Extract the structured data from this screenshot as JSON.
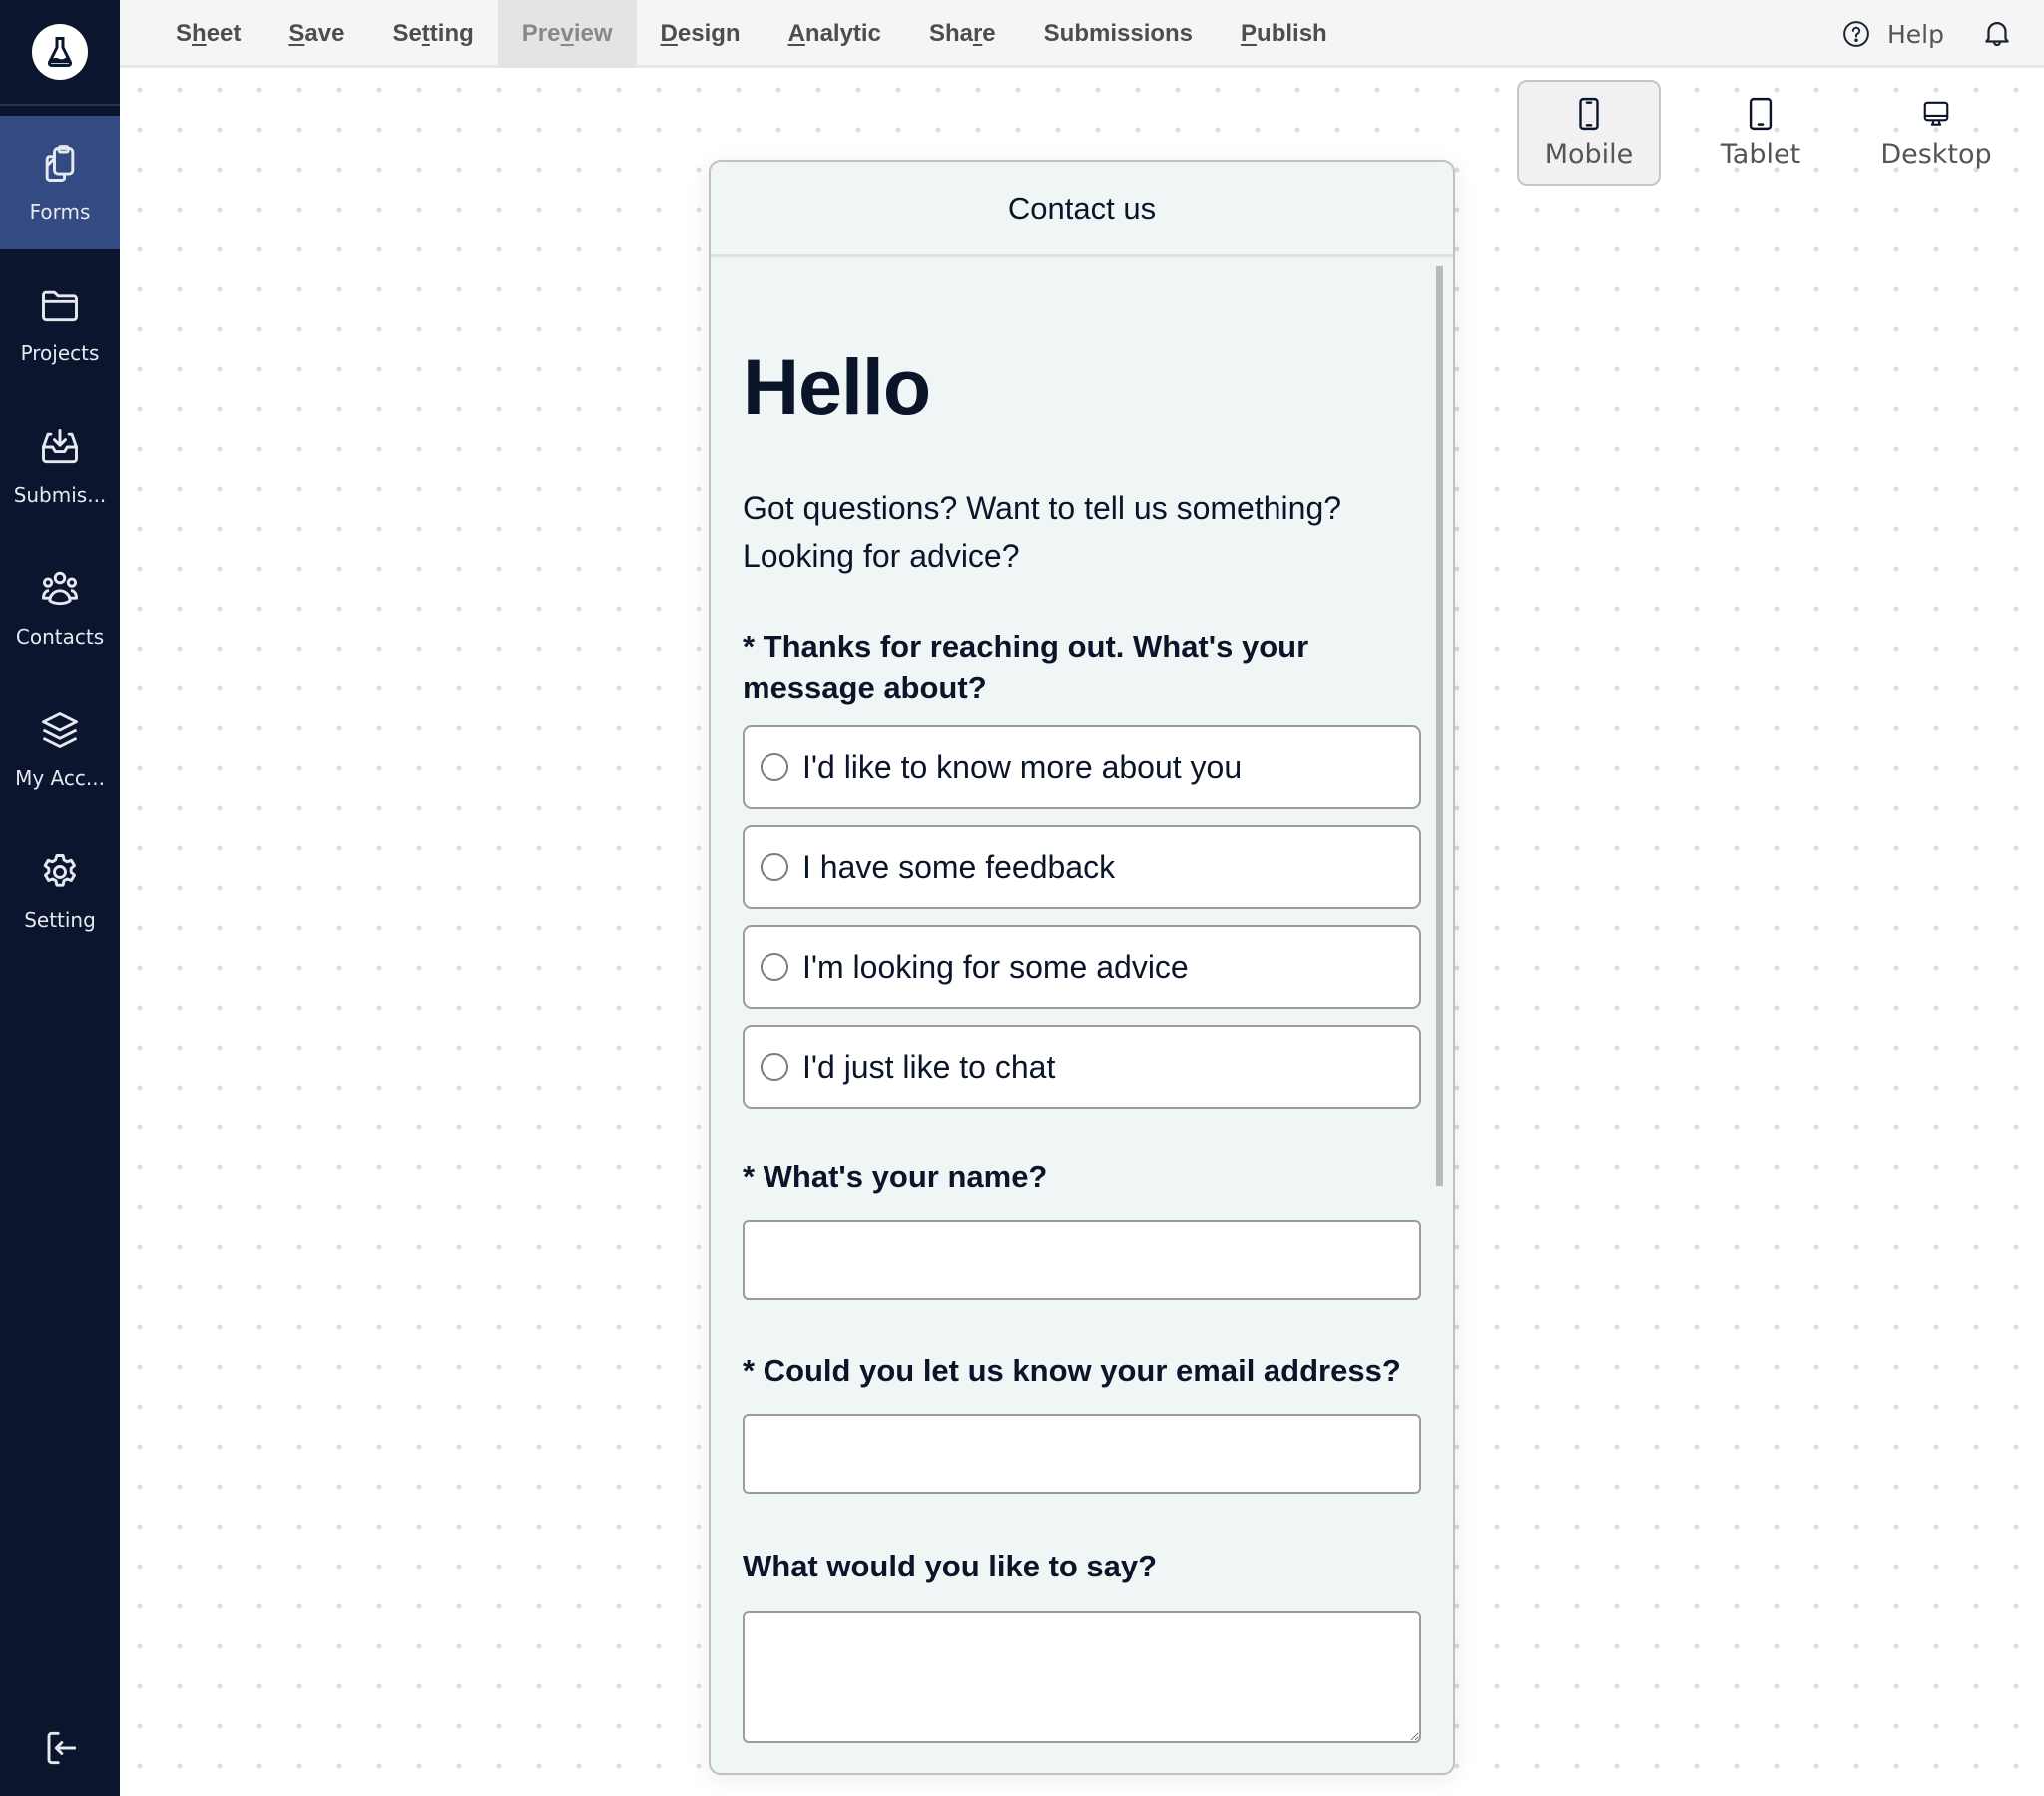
{
  "app": {
    "logo_icon": "flask-icon"
  },
  "sidebar": {
    "items": [
      {
        "label": "Forms",
        "icon": "clipboard-copy-icon",
        "active": true
      },
      {
        "label": "Projects",
        "icon": "folder-icon",
        "active": false
      },
      {
        "label": "Submis...",
        "icon": "inbox-download-icon",
        "active": false
      },
      {
        "label": "Contacts",
        "icon": "users-group-icon",
        "active": false
      },
      {
        "label": "My Acc...",
        "icon": "layers-icon",
        "active": false
      },
      {
        "label": "Setting",
        "icon": "gear-icon",
        "active": false
      }
    ],
    "logout_icon": "logout-icon"
  },
  "topbar": {
    "menu": [
      {
        "pre": "S",
        "u": "h",
        "post": "eet",
        "active": false
      },
      {
        "pre": "",
        "u": "S",
        "post": "ave",
        "active": false
      },
      {
        "pre": "Se",
        "u": "t",
        "post": "ting",
        "active": false
      },
      {
        "pre": "Pre",
        "u": "v",
        "post": "iew",
        "active": true
      },
      {
        "pre": "",
        "u": "D",
        "post": "esign",
        "active": false
      },
      {
        "pre": "",
        "u": "A",
        "post": "nalytic",
        "active": false
      },
      {
        "pre": "Sha",
        "u": "r",
        "post": "e",
        "active": false
      },
      {
        "pre": "Submissions",
        "u": "",
        "post": "",
        "active": false
      },
      {
        "pre": "",
        "u": "P",
        "post": "ublish",
        "active": false
      }
    ],
    "help_label": "Help",
    "help_icon": "help-circle-icon",
    "bell_icon": "bell-icon"
  },
  "devices": {
    "options": [
      {
        "label": "Mobile",
        "icon": "mobile-icon",
        "active": true
      },
      {
        "label": "Tablet",
        "icon": "tablet-icon",
        "active": false
      },
      {
        "label": "Desktop",
        "icon": "desktop-icon",
        "active": false
      }
    ]
  },
  "preview": {
    "title": "Contact us",
    "heading": "Hello",
    "intro_line1": "Got questions? Want to tell us something?",
    "intro_line2": "Looking for advice?",
    "question1": {
      "label": "* Thanks for reaching out. What's your message about?",
      "required": true,
      "options": [
        "I'd like to know more about you",
        "I have some feedback",
        "I'm looking for some advice",
        "I'd just like to chat"
      ],
      "selected": null
    },
    "question2": {
      "label": "* What's your name?",
      "value": "",
      "placeholder": ""
    },
    "question3": {
      "label": "* Could you let us know your email address?",
      "value": "",
      "placeholder": ""
    },
    "question4": {
      "label": "What would you like to say?",
      "value": "",
      "placeholder": ""
    }
  },
  "colors": {
    "sidebar_bg": "#0b152e",
    "sidebar_active": "#344a82",
    "topbar_bg": "#f5f5f5",
    "preview_bg": "#f0f6f6",
    "text_dark": "#0b1529"
  }
}
